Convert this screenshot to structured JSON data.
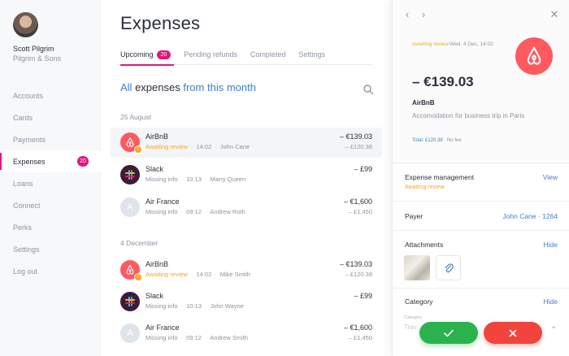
{
  "user": {
    "name": "Scott Pilgrim",
    "company": "Pilgrim & Sons"
  },
  "sidebar": {
    "items": [
      {
        "label": "Accounts"
      },
      {
        "label": "Cards"
      },
      {
        "label": "Payments"
      },
      {
        "label": "Expenses",
        "badge": "20",
        "active": true
      },
      {
        "label": "Loans"
      },
      {
        "label": "Connect"
      },
      {
        "label": "Perks"
      },
      {
        "label": "Settings"
      },
      {
        "label": "Log out"
      }
    ]
  },
  "main": {
    "title": "Expenses",
    "tabs": [
      {
        "label": "Upcoming",
        "badge": "20",
        "active": true
      },
      {
        "label": "Pending refunds"
      },
      {
        "label": "Completed"
      },
      {
        "label": "Settings"
      }
    ],
    "heading": {
      "prefix": "All",
      "middle": "expenses",
      "suffix": "from this month"
    },
    "groups": [
      {
        "date": "25 August",
        "rows": [
          {
            "merchant": "AirBnB",
            "icon": "airbnb-logo-icon",
            "status": "Awaiting review",
            "status_type": "warn",
            "time": "14:02",
            "person": "John Cane",
            "amount": "– €139.03",
            "sub_amount": "– £120.38"
          },
          {
            "merchant": "Slack",
            "icon": "slack-logo-icon",
            "status": "Missing info",
            "status_type": "muted",
            "time": "10:13",
            "person": "Marry Queen",
            "amount": "– £99",
            "sub_amount": ""
          },
          {
            "merchant": "Air France",
            "icon": "initial-avatar-icon",
            "initial": "A",
            "status": "Missing info",
            "status_type": "muted",
            "time": "09:12",
            "person": "Andrew Roth",
            "amount": "– €1,600",
            "sub_amount": "– £1,450"
          }
        ]
      },
      {
        "date": "4 December",
        "rows": [
          {
            "merchant": "AirBnB",
            "icon": "airbnb-logo-icon",
            "status": "Awaiting review",
            "status_type": "warn",
            "time": "14:02",
            "person": "Mike Smith",
            "amount": "– €139.03",
            "sub_amount": "– £120.38"
          },
          {
            "merchant": "Slack",
            "icon": "slack-logo-icon",
            "status": "Missing info",
            "status_type": "muted",
            "time": "10:13",
            "person": "John Wayne",
            "amount": "– £99",
            "sub_amount": ""
          },
          {
            "merchant": "Air France",
            "icon": "initial-avatar-icon",
            "initial": "A",
            "status": "Missing info",
            "status_type": "muted",
            "time": "09:12",
            "person": "Andrew Smith",
            "amount": "– €1,600",
            "sub_amount": "– £1,450"
          }
        ]
      }
    ]
  },
  "panel": {
    "status": "Awaiting review",
    "date": "Wed, 4 Dec, 14:02",
    "amount": "– €139.03",
    "merchant": "AirBnB",
    "description": "Accomodation for business trip in Paris",
    "total": "Total: £120.38",
    "fee": "No fee",
    "sections": {
      "expense_management": {
        "title": "Expense management",
        "link": "View",
        "sub": "Awaiting review"
      },
      "payer": {
        "title": "Payer",
        "link": "John Cane · 1264"
      },
      "attachments": {
        "title": "Attachments",
        "link": "Hide"
      },
      "category": {
        "title": "Category",
        "link": "Hide",
        "field_label": "Category",
        "field_value": "Trav"
      }
    }
  },
  "colors": {
    "accent": "#e0177e",
    "link": "#3d7fd1",
    "warn": "#f5a623",
    "approve": "#2bb24c",
    "reject": "#f0443d"
  }
}
